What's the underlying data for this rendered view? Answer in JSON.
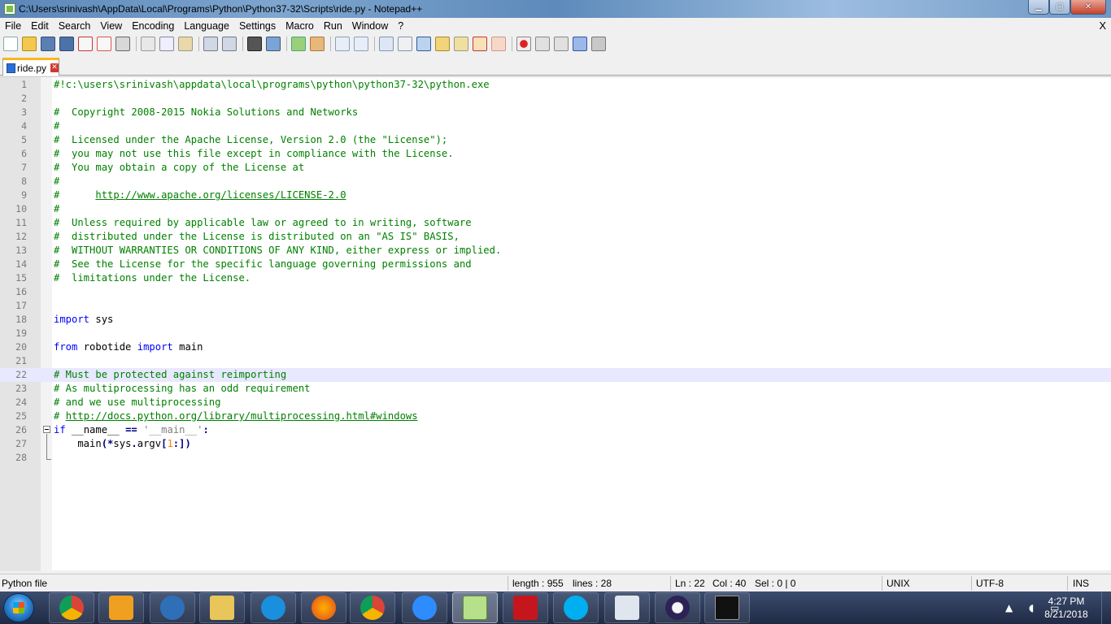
{
  "window": {
    "title": "C:\\Users\\srinivash\\AppData\\Local\\Programs\\Python\\Python37-32\\Scripts\\ride.py - Notepad++",
    "minimize": "▁",
    "maximize": "▢",
    "close": "✕"
  },
  "menu": {
    "items": [
      "File",
      "Edit",
      "Search",
      "View",
      "Encoding",
      "Language",
      "Settings",
      "Macro",
      "Run",
      "Window",
      "?"
    ],
    "close_doc": "X"
  },
  "toolbar": {
    "buttons": [
      "new-file",
      "open-file",
      "save",
      "save-all",
      "close",
      "close-all",
      "print",
      "cut",
      "copy",
      "paste",
      "undo",
      "redo",
      "find",
      "replace",
      "zoom-in",
      "zoom-out",
      "sync-vertical",
      "sync-horizontal",
      "word-wrap",
      "show-all-chars",
      "indent-guide",
      "doc-map",
      "function-list",
      "folder-workspace",
      "doc-switcher",
      "record-macro",
      "stop-record",
      "play-macro",
      "run-macro-multiple",
      "save-macro"
    ]
  },
  "tab": {
    "label": "ride.py",
    "close": "✕"
  },
  "editor": {
    "current_line": 22,
    "lines": [
      {
        "n": "1",
        "parts": [
          {
            "t": "#!c:\\users\\srinivash\\appdata\\local\\programs\\python\\python37-32\\python.exe",
            "c": "comment"
          }
        ]
      },
      {
        "n": "2",
        "parts": []
      },
      {
        "n": "3",
        "parts": [
          {
            "t": "#  Copyright 2008-2015 Nokia Solutions and Networks",
            "c": "comment"
          }
        ]
      },
      {
        "n": "4",
        "parts": [
          {
            "t": "#",
            "c": "comment"
          }
        ]
      },
      {
        "n": "5",
        "parts": [
          {
            "t": "#  Licensed under the Apache License, Version 2.0 (the \"License\");",
            "c": "comment"
          }
        ]
      },
      {
        "n": "6",
        "parts": [
          {
            "t": "#  you may not use this file except in compliance with the License.",
            "c": "comment"
          }
        ]
      },
      {
        "n": "7",
        "parts": [
          {
            "t": "#  You may obtain a copy of the License at",
            "c": "comment"
          }
        ]
      },
      {
        "n": "8",
        "parts": [
          {
            "t": "#",
            "c": "comment"
          }
        ]
      },
      {
        "n": "9",
        "parts": [
          {
            "t": "#      ",
            "c": "comment"
          },
          {
            "t": "http://www.apache.org/licenses/LICENSE-2.0",
            "c": "url"
          }
        ]
      },
      {
        "n": "10",
        "parts": [
          {
            "t": "#",
            "c": "comment"
          }
        ]
      },
      {
        "n": "11",
        "parts": [
          {
            "t": "#  Unless required by applicable law or agreed to in writing, software",
            "c": "comment"
          }
        ]
      },
      {
        "n": "12",
        "parts": [
          {
            "t": "#  distributed under the License is distributed on an \"AS IS\" BASIS,",
            "c": "comment"
          }
        ]
      },
      {
        "n": "13",
        "parts": [
          {
            "t": "#  WITHOUT WARRANTIES OR CONDITIONS OF ANY KIND, either express or implied.",
            "c": "comment"
          }
        ]
      },
      {
        "n": "14",
        "parts": [
          {
            "t": "#  See the License for the specific language governing permissions and",
            "c": "comment"
          }
        ]
      },
      {
        "n": "15",
        "parts": [
          {
            "t": "#  limitations under the License.",
            "c": "comment"
          }
        ]
      },
      {
        "n": "16",
        "parts": []
      },
      {
        "n": "17",
        "parts": []
      },
      {
        "n": "18",
        "parts": [
          {
            "t": "import",
            "c": "kw"
          },
          {
            "t": " sys",
            "c": "plain"
          }
        ]
      },
      {
        "n": "19",
        "parts": []
      },
      {
        "n": "20",
        "parts": [
          {
            "t": "from",
            "c": "kw"
          },
          {
            "t": " robotide ",
            "c": "plain"
          },
          {
            "t": "import",
            "c": "kw"
          },
          {
            "t": " main",
            "c": "plain"
          }
        ]
      },
      {
        "n": "21",
        "parts": []
      },
      {
        "n": "22",
        "parts": [
          {
            "t": "# Must be protected against reimporting",
            "c": "comment"
          }
        ]
      },
      {
        "n": "23",
        "parts": [
          {
            "t": "# As multiprocessing has an odd requirement",
            "c": "comment"
          }
        ]
      },
      {
        "n": "24",
        "parts": [
          {
            "t": "# and we use multiprocessing",
            "c": "comment"
          }
        ]
      },
      {
        "n": "25",
        "parts": [
          {
            "t": "# ",
            "c": "comment"
          },
          {
            "t": "http://docs.python.org/library/multiprocessing.html#windows",
            "c": "url"
          }
        ]
      },
      {
        "n": "26",
        "parts": [
          {
            "t": "if",
            "c": "kw"
          },
          {
            "t": " __name__ ",
            "c": "plain"
          },
          {
            "t": "==",
            "c": "op"
          },
          {
            "t": " ",
            "c": "plain"
          },
          {
            "t": "'__main__'",
            "c": "str"
          },
          {
            "t": ":",
            "c": "op"
          }
        ]
      },
      {
        "n": "27",
        "parts": [
          {
            "t": "    main",
            "c": "plain"
          },
          {
            "t": "(*",
            "c": "op"
          },
          {
            "t": "sys",
            "c": "plain"
          },
          {
            "t": ".",
            "c": "op"
          },
          {
            "t": "argv",
            "c": "plain"
          },
          {
            "t": "[",
            "c": "op"
          },
          {
            "t": "1",
            "c": "num"
          },
          {
            "t": ":])",
            "c": "op"
          }
        ]
      },
      {
        "n": "28",
        "parts": []
      }
    ]
  },
  "status": {
    "file_type": "Python file",
    "length": "length : 955",
    "lines": "lines : 28",
    "ln": "Ln : 22",
    "col": "Col : 40",
    "sel": "Sel : 0 | 0",
    "eol": "UNIX",
    "encoding": "UTF-8",
    "mode": "INS"
  },
  "taskbar": {
    "apps": [
      "chrome",
      "media-player",
      "thunderbird",
      "file-explorer",
      "internet-explorer",
      "firefox",
      "chrome-2",
      "zoom",
      "notepadpp",
      "acrobat",
      "skype",
      "notepad-docs",
      "eclipse",
      "command-prompt"
    ],
    "time": "4:27 PM",
    "date": "8/21/2018"
  },
  "colors": {
    "comment": "#008000",
    "keyword": "#0000ff",
    "string": "#808080",
    "number": "#ff8000",
    "current_line": "#e8e8ff"
  }
}
